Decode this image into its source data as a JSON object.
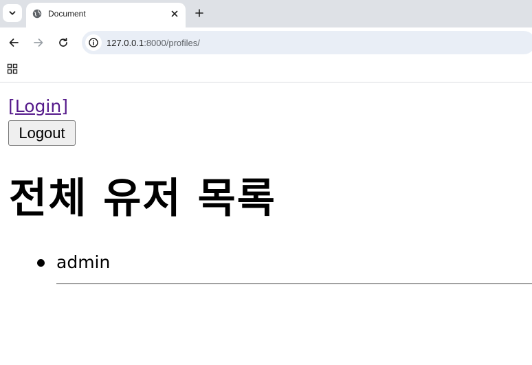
{
  "browser": {
    "tab": {
      "title": "Document"
    },
    "address_bar": {
      "host": "127.0.0.1",
      "path": ":8000/profiles/"
    }
  },
  "page": {
    "login_link": "[Login]",
    "logout_button": "Logout",
    "title": "전체 유저 목록",
    "users": [
      {
        "username": "admin"
      }
    ]
  },
  "colors": {
    "tabstrip_bg": "#dee1e6",
    "omnibox_bg": "#e9eef6",
    "visited_link": "#551a8b"
  }
}
